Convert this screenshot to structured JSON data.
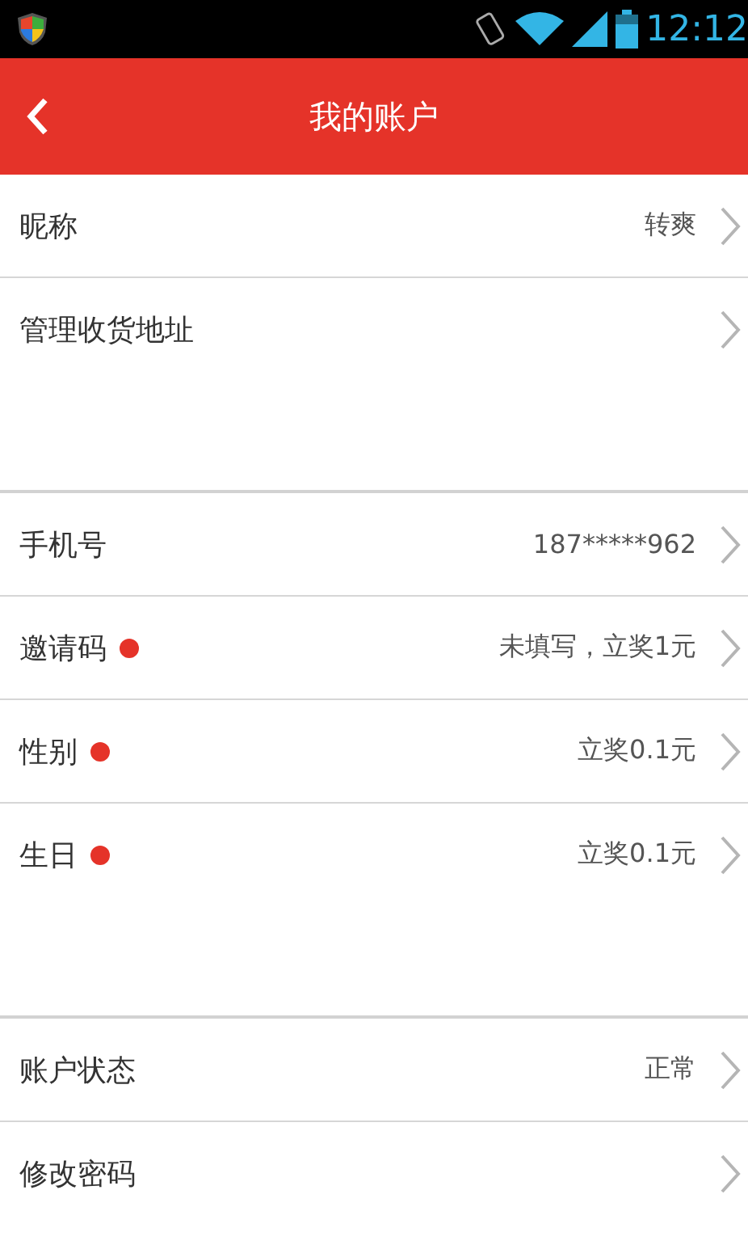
{
  "status_bar": {
    "time": "12:12"
  },
  "header": {
    "title": "我的账户"
  },
  "groups": [
    {
      "rows": [
        {
          "label": "昵称",
          "value": "转爽",
          "dot": false
        },
        {
          "label": "管理收货地址",
          "dot": false
        }
      ]
    },
    {
      "rows": [
        {
          "label": "手机号",
          "value": "187*****962",
          "dot": false
        },
        {
          "label": "邀请码",
          "value": "未填写，立奖1元",
          "dot": true
        },
        {
          "label": "性别",
          "value": "立奖0.1元",
          "dot": true
        },
        {
          "label": "生日",
          "value": "立奖0.1元",
          "dot": true
        }
      ]
    },
    {
      "rows": [
        {
          "label": "账户状态",
          "value": "正常",
          "dot": false
        },
        {
          "label": "修改密码",
          "dot": false
        }
      ]
    }
  ]
}
